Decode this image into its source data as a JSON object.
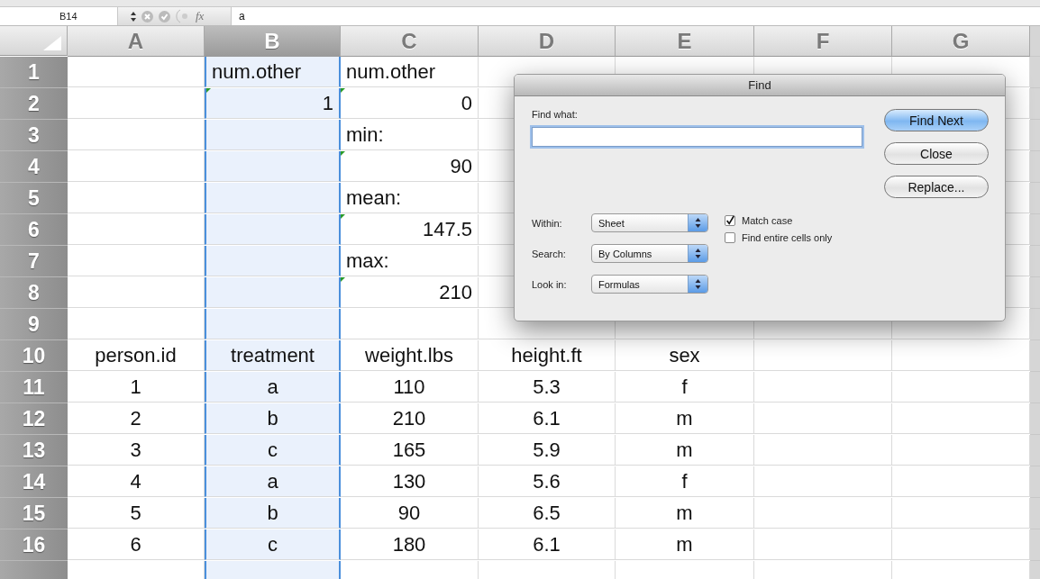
{
  "formula_bar": {
    "name_box": "B14",
    "fx": "fx",
    "value": "a"
  },
  "columns": [
    {
      "label": "A",
      "selected": false
    },
    {
      "label": "B",
      "selected": true
    },
    {
      "label": "C",
      "selected": false
    },
    {
      "label": "D",
      "selected": false
    },
    {
      "label": "E",
      "selected": false
    },
    {
      "label": "F",
      "selected": false
    },
    {
      "label": "G",
      "selected": false
    }
  ],
  "rows": [
    {
      "label": "1",
      "kind": "plain",
      "cells": [
        null,
        {
          "text": "num.other",
          "kind": "text",
          "flagged": false
        },
        {
          "text": "num.other",
          "kind": "text",
          "flagged": false
        },
        null,
        null,
        null,
        null
      ]
    },
    {
      "label": "2",
      "kind": "plain",
      "cells": [
        null,
        {
          "text": "1",
          "kind": "number",
          "flagged": true
        },
        {
          "text": "0",
          "kind": "number",
          "flagged": true
        },
        null,
        null,
        null,
        null
      ]
    },
    {
      "label": "3",
      "kind": "plain",
      "cells": [
        null,
        null,
        {
          "text": "min:",
          "kind": "text",
          "flagged": false
        },
        null,
        null,
        null,
        null
      ]
    },
    {
      "label": "4",
      "kind": "plain",
      "cells": [
        null,
        null,
        {
          "text": "90",
          "kind": "number",
          "flagged": true
        },
        null,
        null,
        null,
        null
      ]
    },
    {
      "label": "5",
      "kind": "plain",
      "cells": [
        null,
        null,
        {
          "text": "mean:",
          "kind": "text",
          "flagged": false
        },
        null,
        null,
        null,
        null
      ]
    },
    {
      "label": "6",
      "kind": "plain",
      "cells": [
        null,
        null,
        {
          "text": "147.5",
          "kind": "number",
          "flagged": true
        },
        null,
        null,
        null,
        null
      ]
    },
    {
      "label": "7",
      "kind": "plain",
      "cells": [
        null,
        null,
        {
          "text": "max:",
          "kind": "text",
          "flagged": false
        },
        null,
        null,
        null,
        null
      ]
    },
    {
      "label": "8",
      "kind": "plain",
      "cells": [
        null,
        null,
        {
          "text": "210",
          "kind": "number",
          "flagged": true
        },
        null,
        null,
        null,
        null
      ]
    },
    {
      "label": "9",
      "cells": [
        null,
        null,
        null,
        null,
        null,
        null,
        null
      ]
    },
    {
      "label": "10",
      "kind": "table",
      "cells": [
        {
          "text": "person.id"
        },
        {
          "text": "treatment"
        },
        {
          "text": "weight.lbs"
        },
        {
          "text": "height.ft"
        },
        {
          "text": "sex"
        },
        null,
        null
      ]
    },
    {
      "label": "11",
      "kind": "table",
      "cells": [
        {
          "text": "1"
        },
        {
          "text": "a"
        },
        {
          "text": "110"
        },
        {
          "text": "5.3"
        },
        {
          "text": "f"
        },
        null,
        null
      ]
    },
    {
      "label": "12",
      "kind": "table",
      "cells": [
        {
          "text": "2"
        },
        {
          "text": "b"
        },
        {
          "text": "210"
        },
        {
          "text": "6.1"
        },
        {
          "text": "m"
        },
        null,
        null
      ]
    },
    {
      "label": "13",
      "kind": "table",
      "cells": [
        {
          "text": "3"
        },
        {
          "text": "c"
        },
        {
          "text": "165"
        },
        {
          "text": "5.9"
        },
        {
          "text": "m"
        },
        null,
        null
      ]
    },
    {
      "label": "14",
      "kind": "table",
      "cells": [
        {
          "text": "4"
        },
        {
          "text": "a"
        },
        {
          "text": "130"
        },
        {
          "text": "5.6"
        },
        {
          "text": "f"
        },
        null,
        null
      ]
    },
    {
      "label": "15",
      "kind": "table",
      "cells": [
        {
          "text": "5"
        },
        {
          "text": "b"
        },
        {
          "text": "90"
        },
        {
          "text": "6.5"
        },
        {
          "text": "m"
        },
        null,
        null
      ]
    },
    {
      "label": "16",
      "kind": "table",
      "cells": [
        {
          "text": "6"
        },
        {
          "text": "c"
        },
        {
          "text": "180"
        },
        {
          "text": "6.1"
        },
        {
          "text": "m"
        },
        null,
        null
      ]
    },
    {
      "cells": [
        null,
        null,
        null,
        null,
        null,
        null,
        null
      ]
    }
  ],
  "find_dialog": {
    "title": "Find",
    "find_what": {
      "label": "Find what:"
    },
    "buttons": [
      {
        "label": "Find Next",
        "default": true
      },
      {
        "label": "Close",
        "default": false
      },
      {
        "label": "Replace...",
        "default": false
      }
    ],
    "options": [
      {
        "label": "Within:",
        "value": "Sheet"
      },
      {
        "label": "Search:",
        "value": "By Columns"
      },
      {
        "label": "Look in:",
        "value": "Formulas"
      }
    ],
    "checkboxes": [
      {
        "label": "Match case",
        "checked": true
      },
      {
        "label": "Find entire cells only",
        "checked": false
      }
    ]
  }
}
